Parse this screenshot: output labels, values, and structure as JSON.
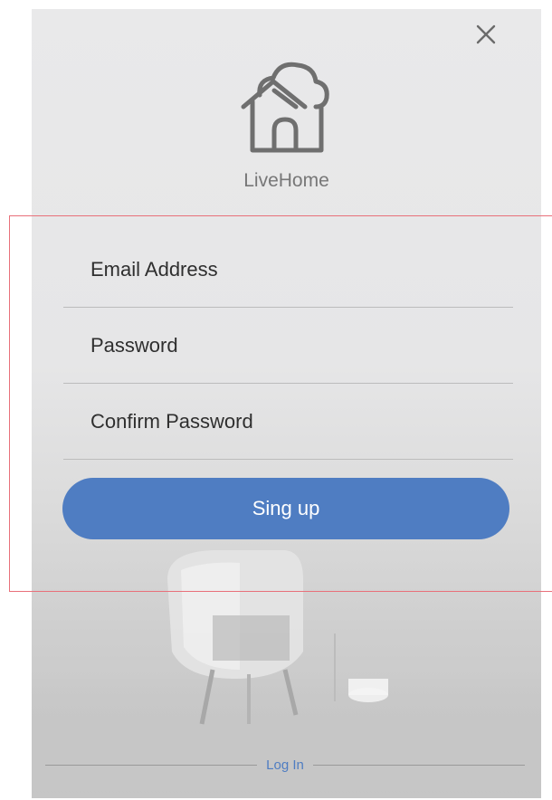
{
  "app": {
    "name": "LiveHome"
  },
  "form": {
    "email_placeholder": "Email Address",
    "password_placeholder": "Password",
    "confirm_placeholder": "Confirm Password",
    "submit_label": "Sing up"
  },
  "footer": {
    "login_label": "Log In"
  },
  "icons": {
    "close": "close-icon",
    "logo": "house-cloud-logo"
  },
  "colors": {
    "accent": "#4f7dc2",
    "highlight_border": "#e8707a",
    "background": "#e9e9ea"
  }
}
